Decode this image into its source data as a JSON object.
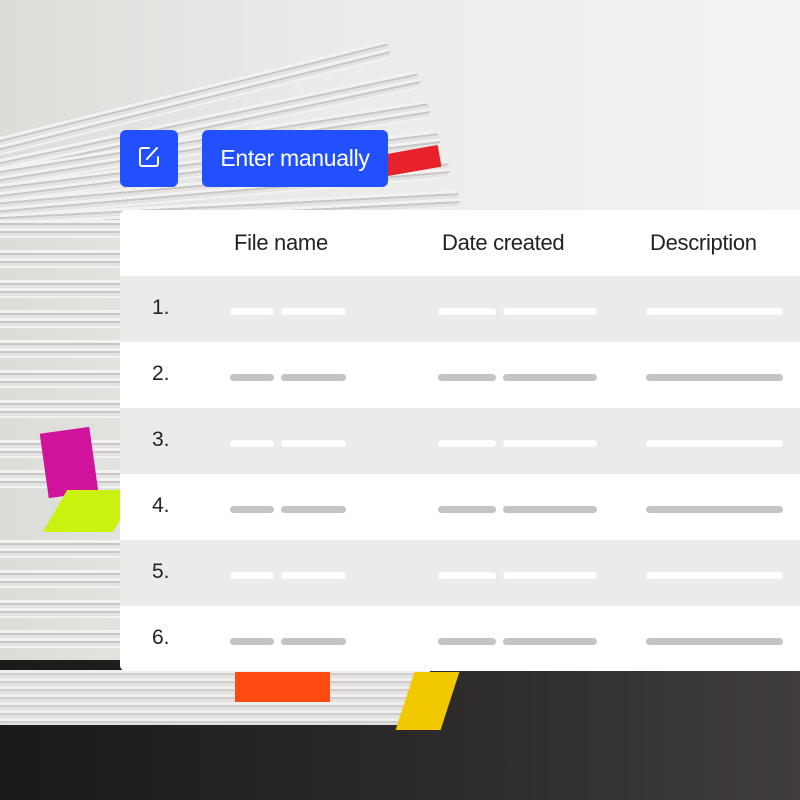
{
  "toolbar": {
    "edit_icon": "edit-square-icon",
    "enter_manually_label": "Enter manually"
  },
  "colors": {
    "accent": "#2350ff",
    "row_alt": "#ebebeb",
    "placeholder_bar": "#c4c4c4"
  },
  "table": {
    "columns": [
      "File name",
      "Date created",
      "Description"
    ],
    "rows": [
      {
        "index": "1."
      },
      {
        "index": "2."
      },
      {
        "index": "3."
      },
      {
        "index": "4."
      },
      {
        "index": "5."
      },
      {
        "index": "6."
      }
    ]
  }
}
